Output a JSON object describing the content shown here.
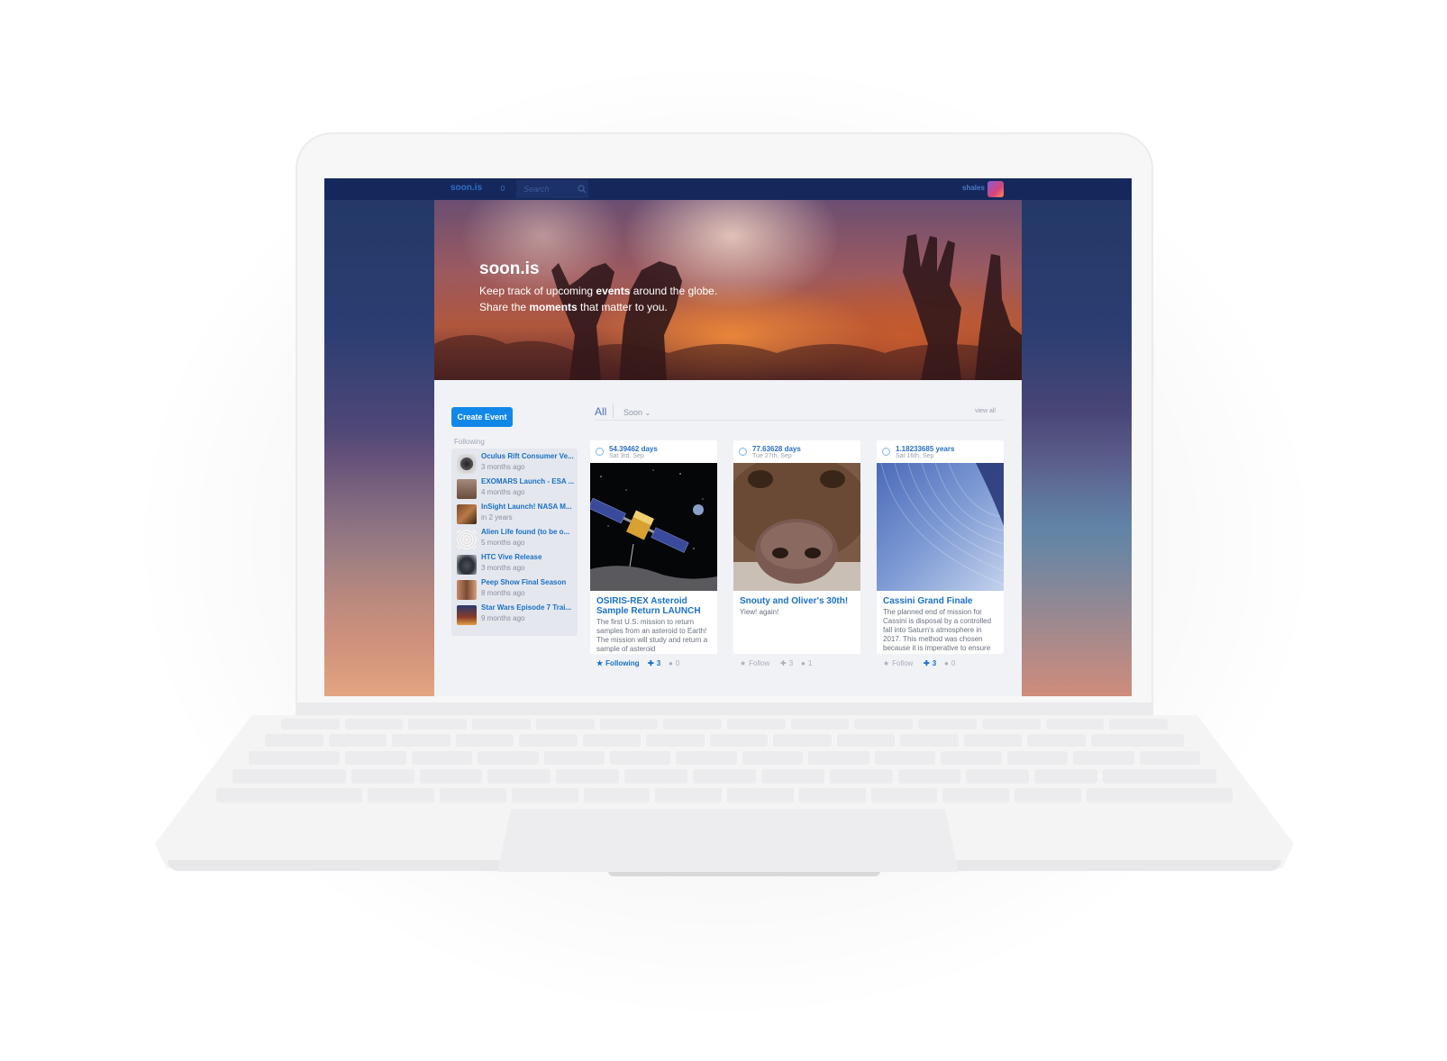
{
  "nav": {
    "logo": "soon.is",
    "notifications": "0",
    "search_placeholder": "Search",
    "username": "shales"
  },
  "hero": {
    "title": "soon.is",
    "line1_a": "Keep track of upcoming ",
    "line1_b": "events",
    "line1_c": " around the globe.",
    "line2_a": "Share the ",
    "line2_b": "moments",
    "line2_c": " that matter to you."
  },
  "sidebar": {
    "create_button": "Create Event",
    "following_label": "Following",
    "items": [
      {
        "title": "Oculus Rift Consumer Ve...",
        "time": "3 months ago"
      },
      {
        "title": "EXOMARS Launch - ESA ...",
        "time": "4 months ago"
      },
      {
        "title": "InSight Launch! NASA M...",
        "time": "in 2 years"
      },
      {
        "title": "Alien Life found (to be o...",
        "time": "5 months ago"
      },
      {
        "title": "HTC Vive Release",
        "time": "3 months ago"
      },
      {
        "title": "Peep Show Final Season",
        "time": "8 months ago"
      },
      {
        "title": "Star Wars Episode 7 Trai...",
        "time": "9 months ago"
      }
    ]
  },
  "filters": {
    "all": "All",
    "soon": "Soon",
    "view_all": "view all"
  },
  "cards": [
    {
      "countdown": "54.39462 days",
      "date": "Sat 3rd, Sep",
      "title": "OSIRIS-REX Asteroid Sample Return LAUNCH",
      "desc": "The first U.S. mission to return samples from an asteroid to Earth! The mission will study and return a sample of asteroid",
      "follow": "Following",
      "plus": "3",
      "comments": "0"
    },
    {
      "countdown": "77.63628 days",
      "date": "Tue 27th, Sep",
      "title": "Snouty and Oliver's 30th!",
      "desc": "Yiew! again!",
      "follow": "Follow",
      "plus": "3",
      "comments": "1"
    },
    {
      "countdown": "1.18233685 years",
      "date": "Sat 16th, Sep",
      "title": "Cassini Grand Finale",
      "desc": "The planned end of mission for Cassini is disposal by a controlled fall into Saturn's atmosphere in 2017. This method was chosen because it is imperative to ensure",
      "follow": "Follow",
      "plus": "3",
      "comments": "0"
    }
  ],
  "colors": {
    "accent": "#1187e8",
    "link": "#1a70c4",
    "nav_bg": "#15285c"
  }
}
